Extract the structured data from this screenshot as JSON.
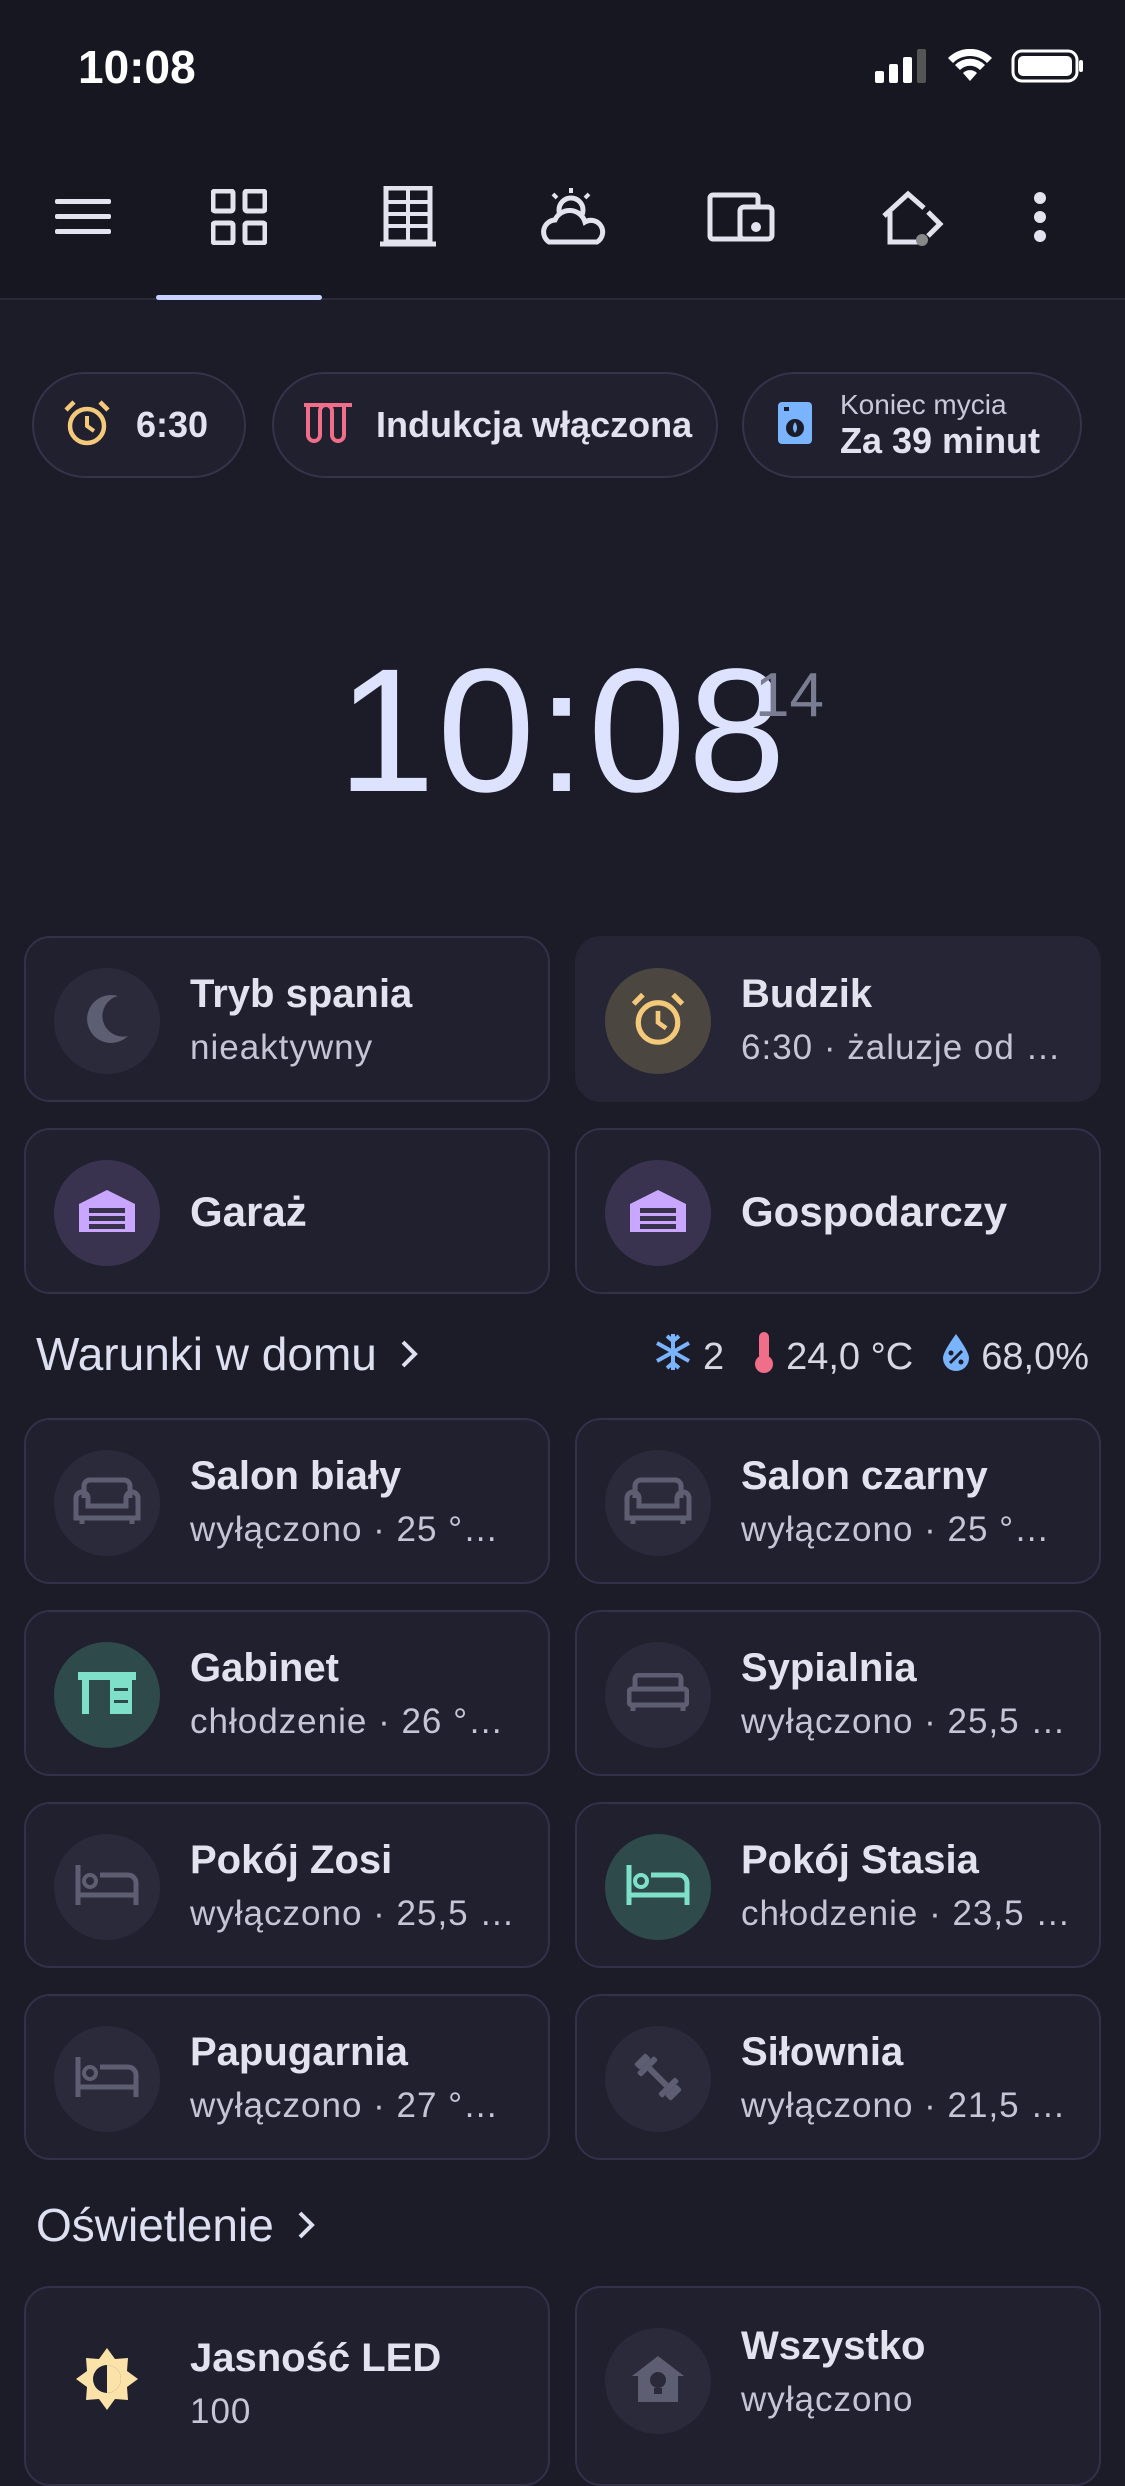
{
  "status_bar": {
    "time": "10:08"
  },
  "nav": {
    "items": [
      {
        "icon": "menu-icon"
      },
      {
        "icon": "dashboard-grid-icon",
        "active": true
      },
      {
        "icon": "building-icon"
      },
      {
        "icon": "weather-icon"
      },
      {
        "icon": "devices-icon"
      },
      {
        "icon": "home-arrow-icon"
      },
      {
        "icon": "more-vert-icon"
      }
    ]
  },
  "chips": {
    "alarm": {
      "icon": "alarm-clock-icon",
      "label": "6:30"
    },
    "induction": {
      "icon": "induction-hob-icon",
      "label": "Indukcja włączona",
      "color": "#f06e8a"
    },
    "dishwasher": {
      "icon": "dishwasher-icon",
      "label_small": "Koniec mycia",
      "label_big": "Za 39 minut",
      "color": "#7ab4ff"
    }
  },
  "clock": {
    "time": "10:08",
    "seconds": "14"
  },
  "tiles_top": [
    {
      "title": "Tryb spania",
      "subtitle": "nieaktywny",
      "icon": "moon-icon"
    },
    {
      "title": "Budzik",
      "subtitle": "6:30 · żaluzje od …",
      "icon": "alarm-clock-icon"
    },
    {
      "title": "Garaż",
      "icon": "garage-icon"
    },
    {
      "title": "Gospodarczy",
      "icon": "garage-icon"
    }
  ],
  "conditions": {
    "title": "Warunki w domu",
    "cooling_count": "2",
    "temperature": "24,0 °C",
    "humidity": "68,0%"
  },
  "rooms": [
    {
      "title": "Salon biały",
      "subtitle": "wyłączono · 25 °…",
      "icon": "sofa-icon"
    },
    {
      "title": "Salon czarny",
      "subtitle": "wyłączono · 25 °…",
      "icon": "sofa-icon"
    },
    {
      "title": "Gabinet",
      "subtitle": "chłodzenie · 26 °…",
      "icon": "desk-icon",
      "active": true
    },
    {
      "title": "Sypialnia",
      "subtitle": "wyłączono · 25,5 …",
      "icon": "bed-double-icon"
    },
    {
      "title": "Pokój Zosi",
      "subtitle": "wyłączono · 25,5 …",
      "icon": "bed-icon"
    },
    {
      "title": "Pokój Stasia",
      "subtitle": "chłodzenie · 23,5 …",
      "icon": "bed-icon",
      "active": true
    },
    {
      "title": "Papugarnia",
      "subtitle": "wyłączono · 27 °…",
      "icon": "bed-icon"
    },
    {
      "title": "Siłownia",
      "subtitle": "wyłączono · 21,5 …",
      "icon": "dumbbell-icon"
    }
  ],
  "lighting": {
    "title": "Oświetlenie",
    "tiles": [
      {
        "title": "Jasność LED",
        "subtitle": "100",
        "icon": "brightness-icon"
      },
      {
        "title": "Wszystko",
        "subtitle": "wyłączono",
        "icon": "home-lightbulb-icon"
      }
    ]
  },
  "colors": {
    "background": "#1c1c28",
    "accent": "#c6d2ff",
    "alarm": "#f5c97a",
    "garage": "#c9a6ff",
    "cooling": "#7ee0c8",
    "thermometer": "#f06e8a",
    "snowflake": "#7ab4ff"
  }
}
